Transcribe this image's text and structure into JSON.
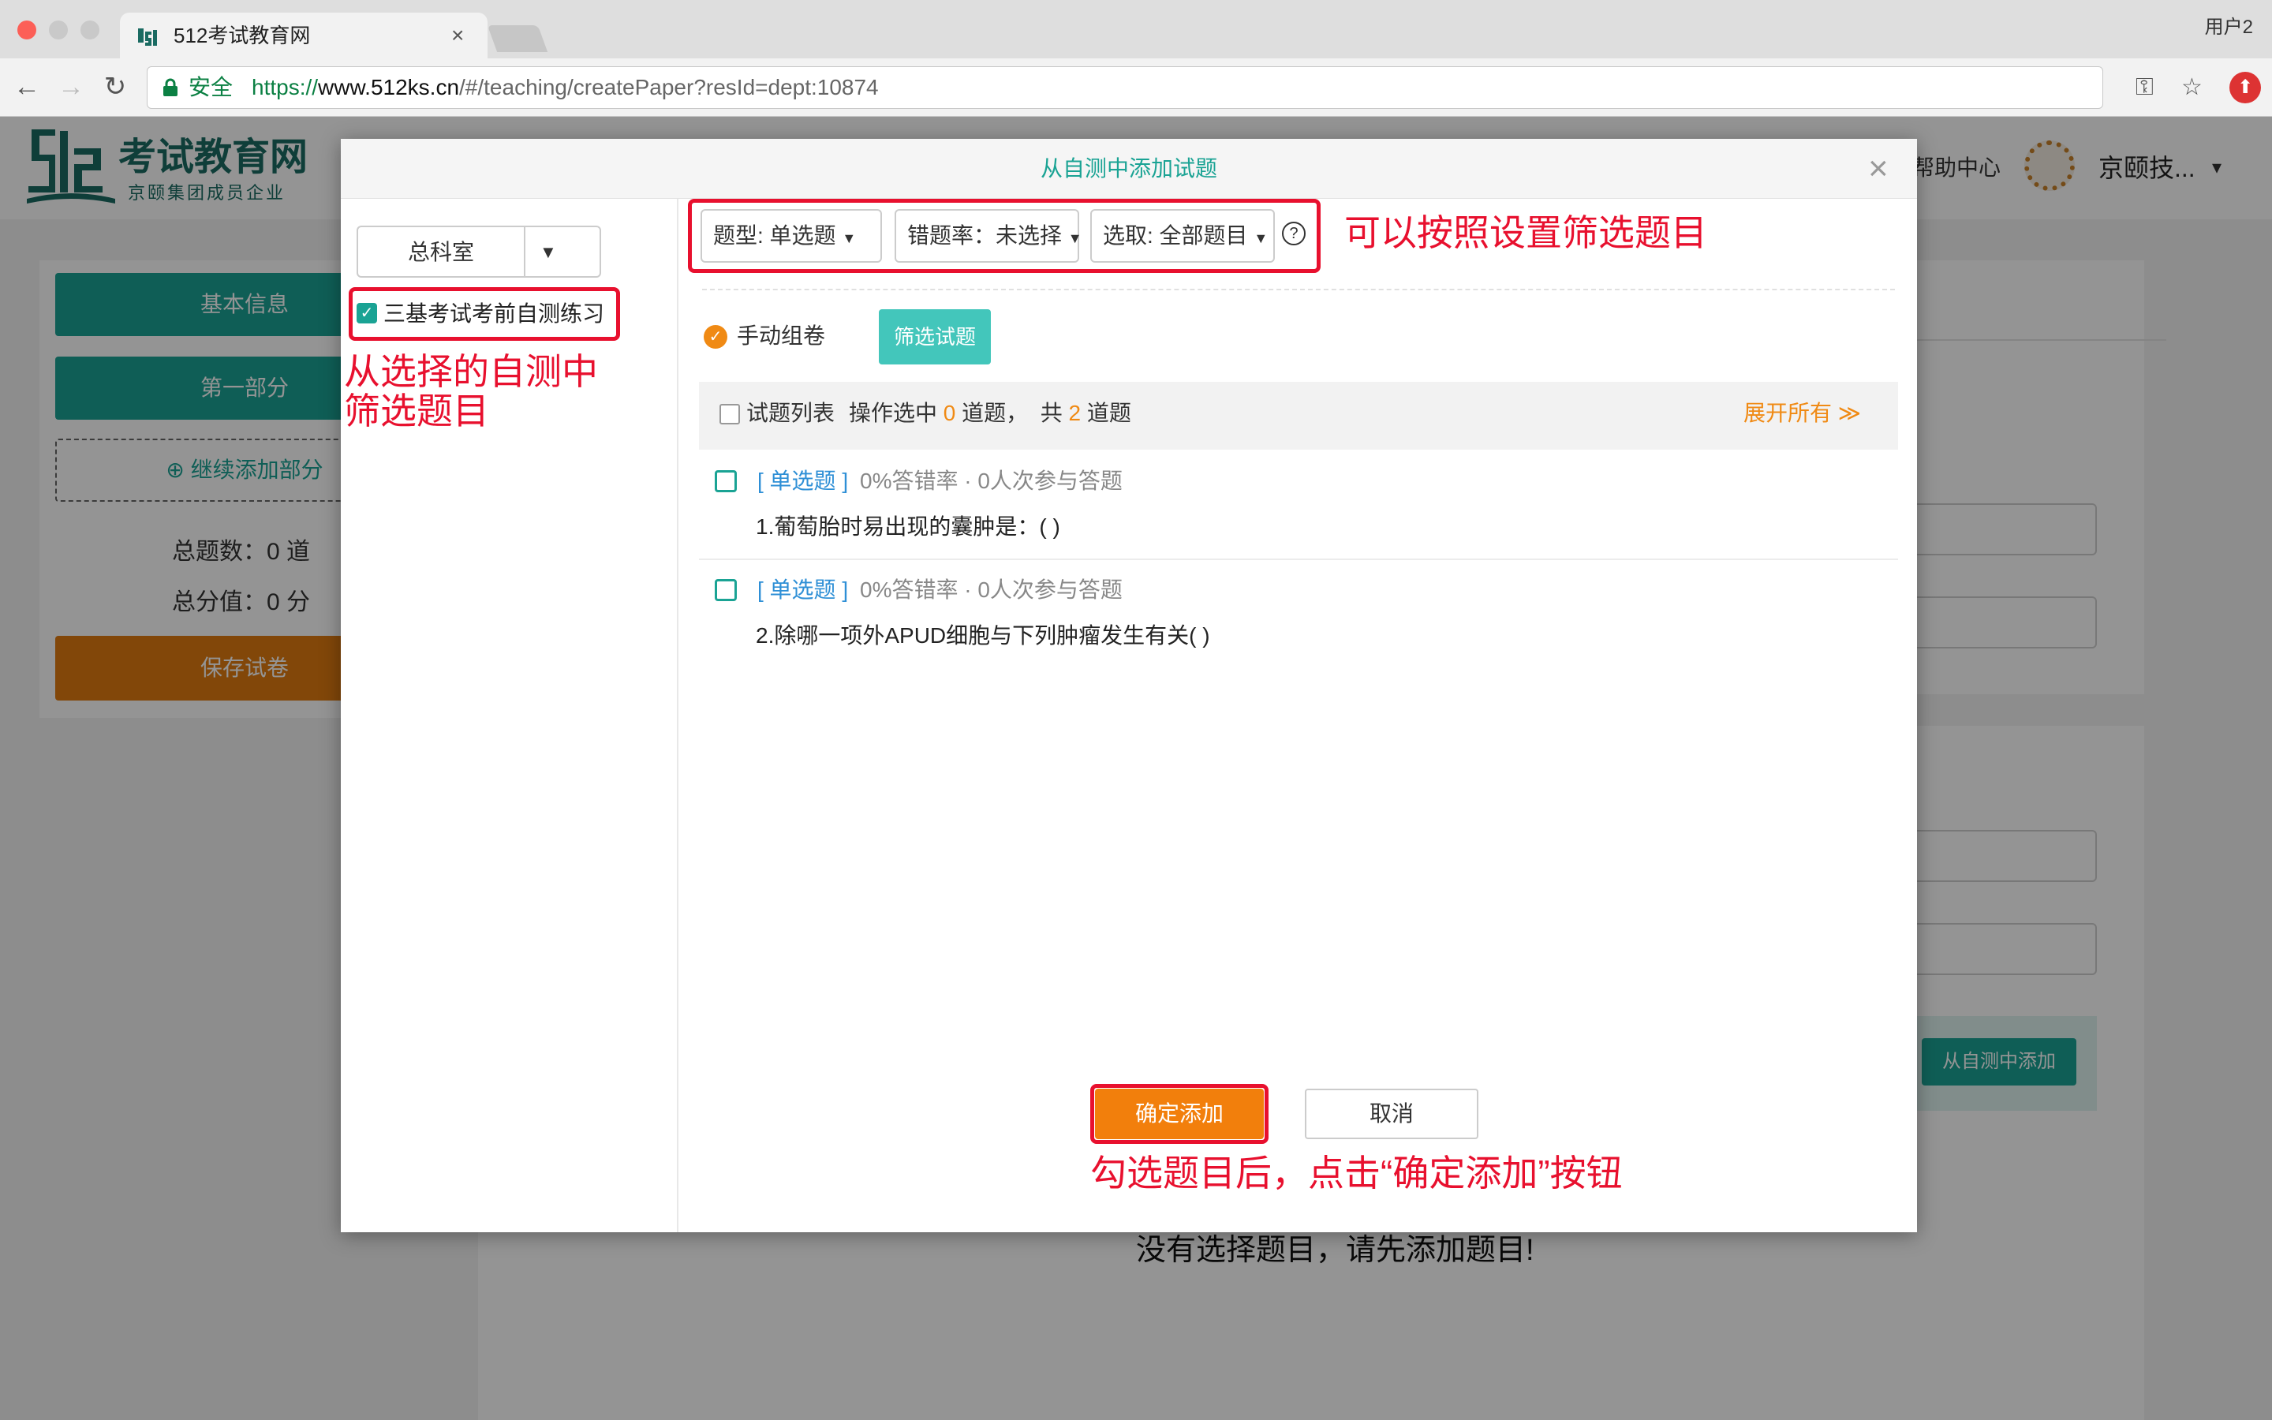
{
  "browser": {
    "tab_title": "512考试教育网",
    "tab_close": "×",
    "user_label": "用户2",
    "secure_label": "安全",
    "url_scheme": "https://",
    "url_host": "www.512ks.cn",
    "url_path": "/#/teaching/createPaper?resId=dept:10874",
    "icons": [
      "back-icon",
      "forward-icon",
      "reload-icon",
      "lock-icon",
      "key-icon",
      "star-icon",
      "extension-icon"
    ]
  },
  "site": {
    "logo_main": "考试教育网",
    "logo_sub": "京颐集团成员企业",
    "help_center": "帮助中心",
    "org_name": "京颐技...",
    "org_caret": "▾"
  },
  "background_page": {
    "basic_info": "基本信息",
    "part_one": "第一部分",
    "add_part": "⊕ 继续添加部分",
    "total_questions": "总题数：0 道",
    "total_score": "总分值：0 分",
    "save_paper": "保存试卷",
    "add_from_selftest": "从自测中添加",
    "empty_message": "没有选择题目，请先添加题目!"
  },
  "modal": {
    "title": "从自测中添加试题",
    "close": "×",
    "dept_select": "总科室",
    "selftest_item": "三基考试考前自测练习",
    "filters": {
      "type": "题型: 单选题",
      "error_rate": "错题率：未选择",
      "pick": "选取: 全部题目",
      "help": "?"
    },
    "manual_compose": "手动组卷",
    "filter_button": "筛选试题",
    "list_header": {
      "label": "试题列表",
      "selected_prefix": "操作选中",
      "selected_count": "0",
      "selected_suffix": "道题，",
      "total_prefix": "共",
      "total_count": "2",
      "total_suffix": "道题",
      "expand_all": "展开所有 ≫"
    },
    "questions": [
      {
        "tag": "[ 单选题 ]",
        "meta": "0%答错率 · 0人次参与答题",
        "text": "1.葡萄胎时易出现的囊肿是：( )"
      },
      {
        "tag": "[ 单选题 ]",
        "meta": "0%答错率 · 0人次参与答题",
        "text": "2.除哪一项外APUD细胞与下列肿瘤发生有关( )"
      }
    ],
    "confirm": "确定添加",
    "cancel": "取消"
  },
  "annotations": {
    "filter_hint": "可以按照设置筛选题目",
    "selftest_hint_line1": "从选择的自测中",
    "selftest_hint_line2": "筛选题目",
    "confirm_hint": "勾选题目后，点击“确定添加”按钮"
  },
  "colors": {
    "brand_teal": "#1aa394",
    "accent_orange": "#f27f0c",
    "annotation_red": "#e8102e"
  }
}
